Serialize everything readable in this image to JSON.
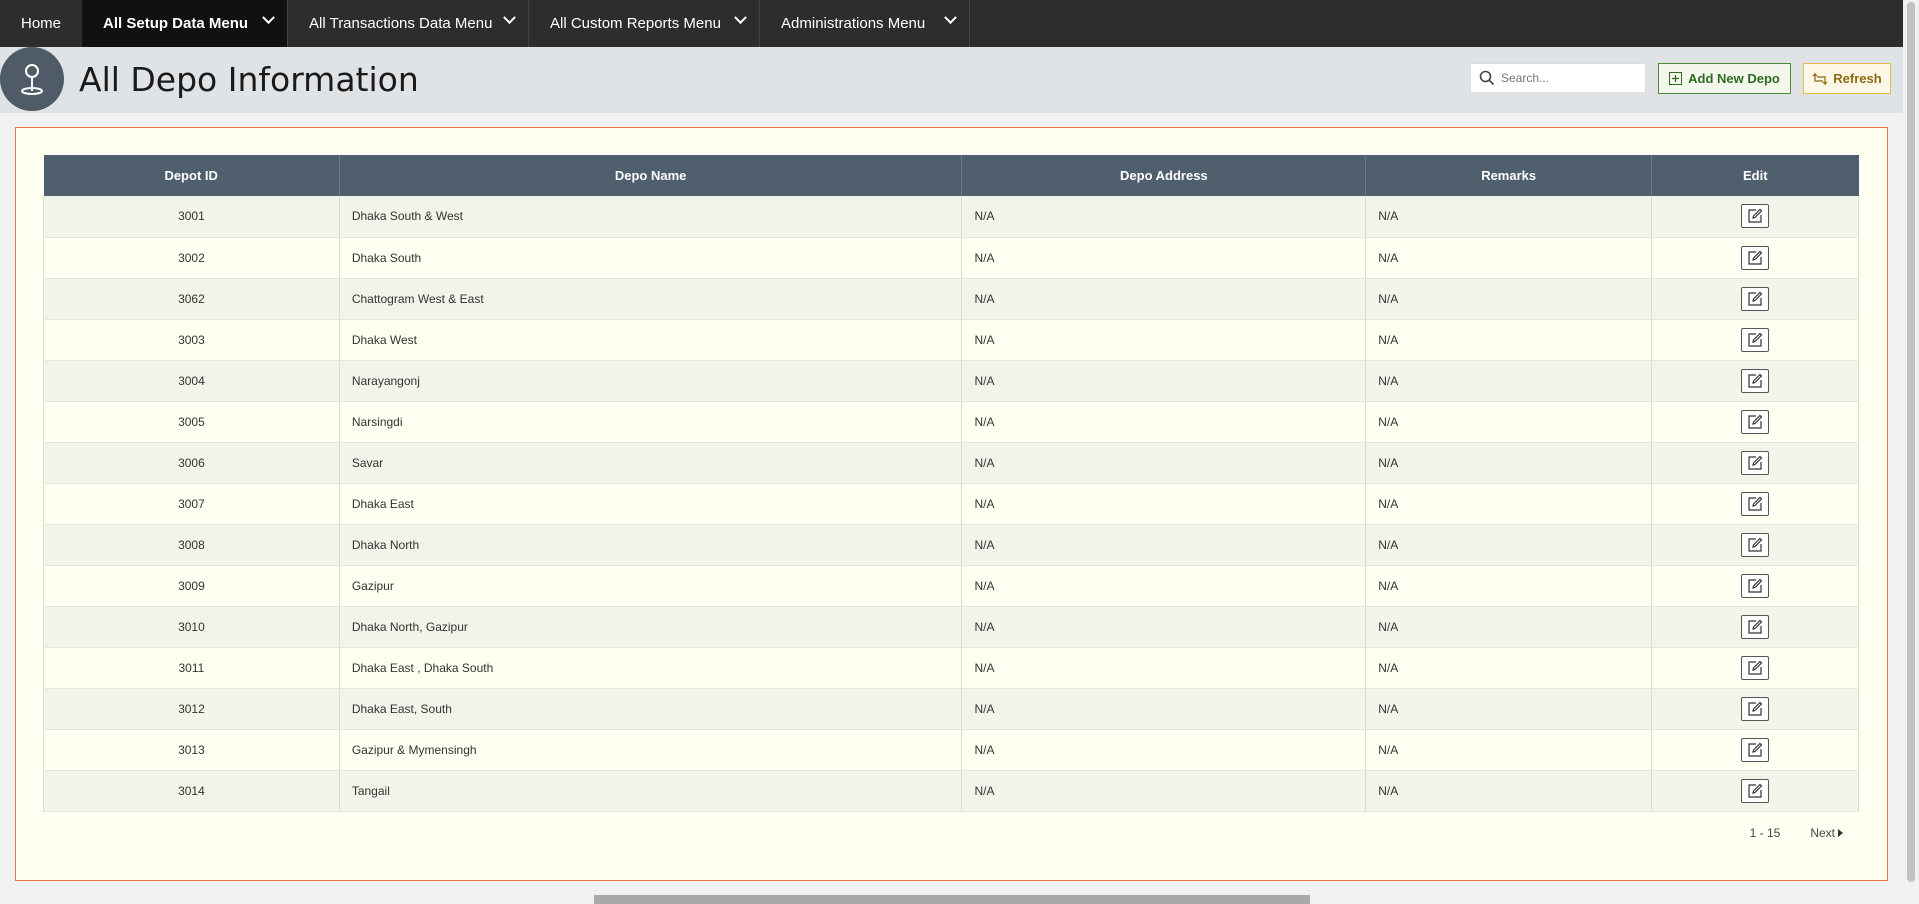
{
  "nav": {
    "home": "Home",
    "menus": [
      "All Setup Data Menu",
      "All Transactions Data Menu",
      "All Custom Reports Menu",
      "Administrations Menu"
    ]
  },
  "header": {
    "title": "All Depo Information",
    "search_placeholder": "Search...",
    "add_label": "Add New Depo",
    "refresh_label": "Refresh"
  },
  "table": {
    "columns": [
      "Depot ID",
      "Depo Name",
      "Depo Address",
      "Remarks",
      "Edit"
    ],
    "rows": [
      {
        "id": "3001",
        "name": "Dhaka South & West",
        "address": "N/A",
        "remarks": "N/A"
      },
      {
        "id": "3002",
        "name": "Dhaka South",
        "address": "N/A",
        "remarks": "N/A"
      },
      {
        "id": "3062",
        "name": "Chattogram West & East",
        "address": "N/A",
        "remarks": "N/A"
      },
      {
        "id": "3003",
        "name": "Dhaka West",
        "address": "N/A",
        "remarks": "N/A"
      },
      {
        "id": "3004",
        "name": "Narayangonj",
        "address": "N/A",
        "remarks": "N/A"
      },
      {
        "id": "3005",
        "name": "Narsingdi",
        "address": "N/A",
        "remarks": "N/A"
      },
      {
        "id": "3006",
        "name": "Savar",
        "address": "N/A",
        "remarks": "N/A"
      },
      {
        "id": "3007",
        "name": "Dhaka East",
        "address": "N/A",
        "remarks": "N/A"
      },
      {
        "id": "3008",
        "name": "Dhaka North",
        "address": "N/A",
        "remarks": "N/A"
      },
      {
        "id": "3009",
        "name": "Gazipur",
        "address": "N/A",
        "remarks": "N/A"
      },
      {
        "id": "3010",
        "name": "Dhaka North, Gazipur",
        "address": "N/A",
        "remarks": "N/A"
      },
      {
        "id": "3011",
        "name": "Dhaka East , Dhaka South",
        "address": "N/A",
        "remarks": "N/A"
      },
      {
        "id": "3012",
        "name": "Dhaka East, South",
        "address": "N/A",
        "remarks": "N/A"
      },
      {
        "id": "3013",
        "name": "Gazipur & Mymensingh",
        "address": "N/A",
        "remarks": "N/A"
      },
      {
        "id": "3014",
        "name": "Tangail",
        "address": "N/A",
        "remarks": "N/A"
      }
    ]
  },
  "pagination": {
    "range": "1 - 15",
    "next_label": "Next"
  }
}
